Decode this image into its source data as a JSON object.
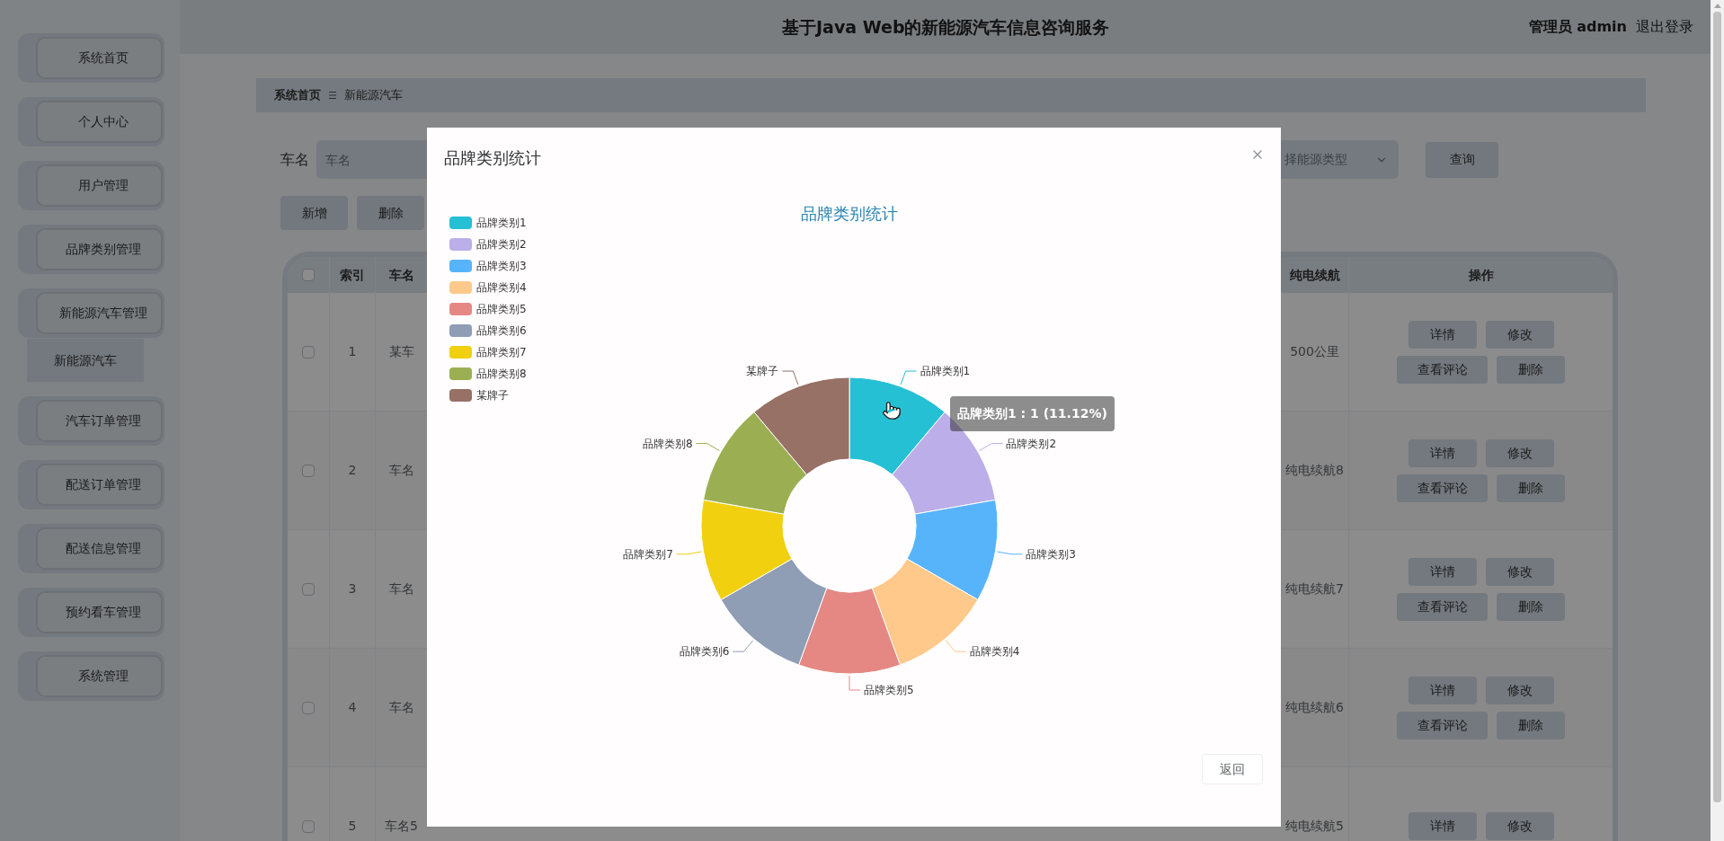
{
  "header": {
    "title": "基于Java Web的新能源汽车信息咨询服务",
    "user": "管理员 admin",
    "logout": "退出登录"
  },
  "sidebar": {
    "items": [
      {
        "label": "系统首页"
      },
      {
        "label": "个人中心"
      },
      {
        "label": "用户管理"
      },
      {
        "label": "品牌类别管理"
      },
      {
        "label": "新能源汽车管理",
        "children": [
          {
            "label": "新能源汽车"
          }
        ]
      },
      {
        "label": "汽车订单管理"
      },
      {
        "label": "配送订单管理"
      },
      {
        "label": "配送信息管理"
      },
      {
        "label": "预约看车管理"
      },
      {
        "label": "系统管理"
      }
    ]
  },
  "breadcrumb": [
    "系统首页",
    "新能源汽车"
  ],
  "search": {
    "label": "车名",
    "placeholder": "车名",
    "select_text": "择能源类型",
    "button": "查询"
  },
  "toolbar": [
    "新增",
    "删除"
  ],
  "table": {
    "select_all_checked": false,
    "columns": [
      "索引",
      "车名",
      "纯电续航",
      "操作"
    ],
    "rows": [
      {
        "checked": false,
        "index": "1",
        "name": "某车",
        "range": "500公里",
        "actions": [
          "详情",
          "修改",
          "查看评论",
          "删除"
        ]
      },
      {
        "checked": false,
        "index": "2",
        "name": "车名",
        "range": "纯电续航8",
        "actions": [
          "详情",
          "修改",
          "查看评论",
          "删除"
        ]
      },
      {
        "checked": false,
        "index": "3",
        "name": "车名",
        "range": "纯电续航7",
        "actions": [
          "详情",
          "修改",
          "查看评论",
          "删除"
        ]
      },
      {
        "checked": false,
        "index": "4",
        "name": "车名",
        "range": "纯电续航6",
        "actions": [
          "详情",
          "修改",
          "查看评论",
          "删除"
        ]
      },
      {
        "checked": false,
        "index": "5",
        "name": "车名5",
        "range": "纯电续航5",
        "actions": [
          "详情",
          "修改"
        ]
      }
    ]
  },
  "modal": {
    "title": "品牌类别统计",
    "legend": [
      {
        "label": "品牌类别1",
        "color": "#26c0d5"
      },
      {
        "label": "品牌类别2",
        "color": "#bcaee8"
      },
      {
        "label": "品牌类别3",
        "color": "#58b4fa"
      },
      {
        "label": "品牌类别4",
        "color": "#fec98b"
      },
      {
        "label": "品牌类别5",
        "color": "#e58883"
      },
      {
        "label": "品牌类别6",
        "color": "#8f9db5"
      },
      {
        "label": "品牌类别7",
        "color": "#f1d00f"
      },
      {
        "label": "品牌类别8",
        "color": "#9baf52"
      },
      {
        "label": "某牌子",
        "color": "#977066"
      }
    ],
    "chart_data": {
      "type": "donut",
      "title": "品牌类别统计",
      "categories": [
        "品牌类别1",
        "品牌类别2",
        "品牌类别3",
        "品牌类别4",
        "品牌类别5",
        "品牌类别6",
        "品牌类别7",
        "品牌类别8",
        "某牌子"
      ],
      "values": [
        1,
        1,
        1,
        1,
        1,
        1,
        1,
        1,
        1
      ]
    },
    "tooltip": "品牌类别1 : 1 (11.12%)",
    "button": "返回"
  }
}
